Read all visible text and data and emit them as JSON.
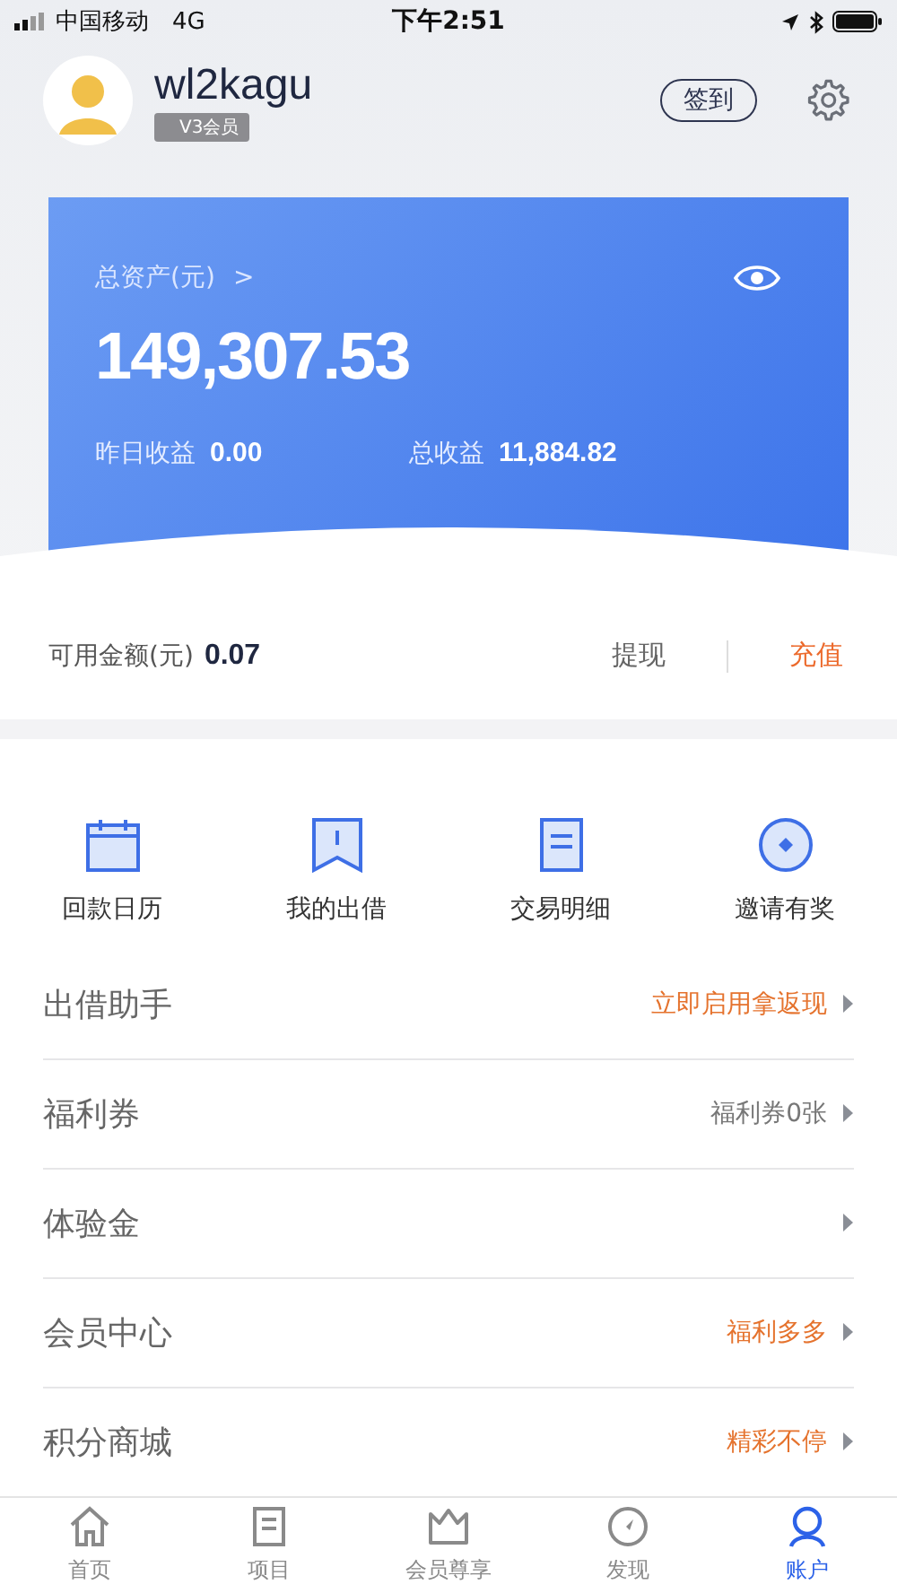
{
  "status_bar": {
    "carrier": "中国移动",
    "network": "4G",
    "time": "下午2:51"
  },
  "profile": {
    "username": "wl2kagu",
    "level_badge": "V3会员",
    "checkin_button": "签到"
  },
  "assets_card": {
    "total_label": "总资产(元)",
    "total_chevron": ">",
    "total_value": "149,307.53",
    "yesterday_label": "昨日收益",
    "yesterday_value": "0.00",
    "earnings_label": "总收益",
    "earnings_value": "11,884.82"
  },
  "balance": {
    "label": "可用金额(元)",
    "value": "0.07",
    "withdraw": "提现",
    "recharge": "充值"
  },
  "shortcuts": [
    {
      "kind": "calendar",
      "label": "回款日历"
    },
    {
      "kind": "bookmark",
      "label": "我的出借"
    },
    {
      "kind": "document",
      "label": "交易明细"
    },
    {
      "kind": "invite",
      "label": "邀请有奖"
    }
  ],
  "menu": [
    {
      "label": "出借助手",
      "value": "立即启用拿返现",
      "color": "#e5732e"
    },
    {
      "label": "福利券",
      "value": "福利券0张",
      "color": "#777777"
    },
    {
      "label": "体验金"
    },
    {
      "label": "会员中心",
      "value": "福利多多",
      "color": "#e5732e"
    },
    {
      "label": "积分商城",
      "value": "精彩不停",
      "color": "#e5732e"
    }
  ],
  "tab_bar": [
    {
      "kind": "home",
      "label": "首页",
      "selected": false
    },
    {
      "kind": "project",
      "label": "项目",
      "selected": false
    },
    {
      "kind": "crown",
      "label": "会员尊享",
      "selected": false
    },
    {
      "kind": "compass",
      "label": "发现",
      "selected": false
    },
    {
      "kind": "account",
      "label": "账户",
      "selected": true
    }
  ]
}
